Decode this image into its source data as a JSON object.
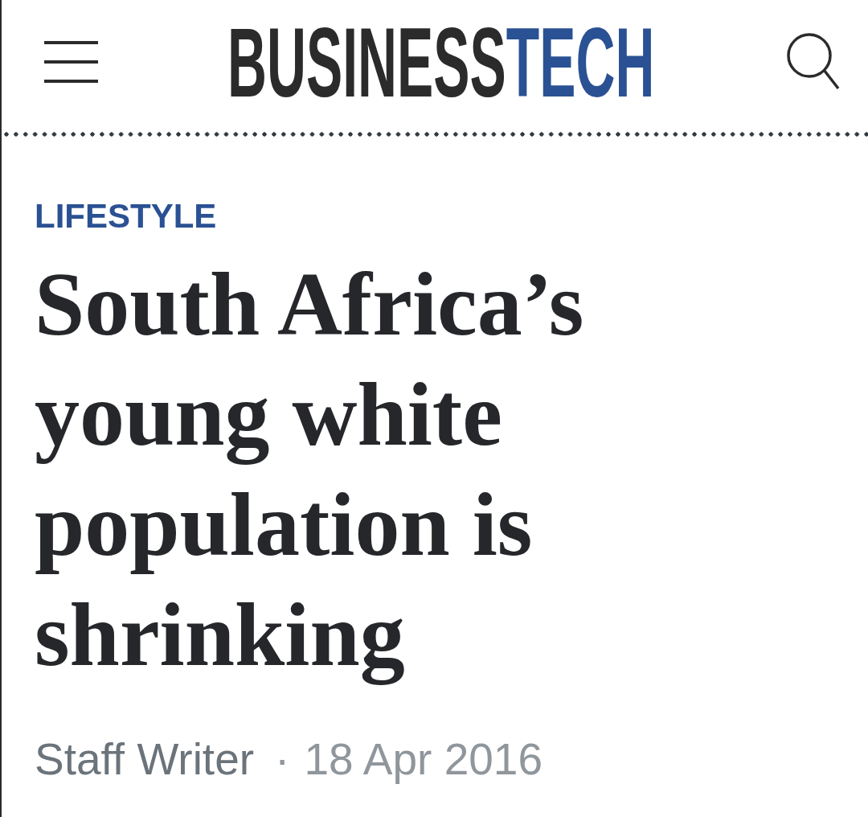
{
  "header": {
    "logo": {
      "main": "BUSINESS",
      "accent": "TECH"
    }
  },
  "article": {
    "category": "LIFESTYLE",
    "headline": "South Africa’s young white population is shrinking",
    "byline": {
      "author": "Staff Writer",
      "separator": "·",
      "date": "18 Apr 2016"
    }
  }
}
